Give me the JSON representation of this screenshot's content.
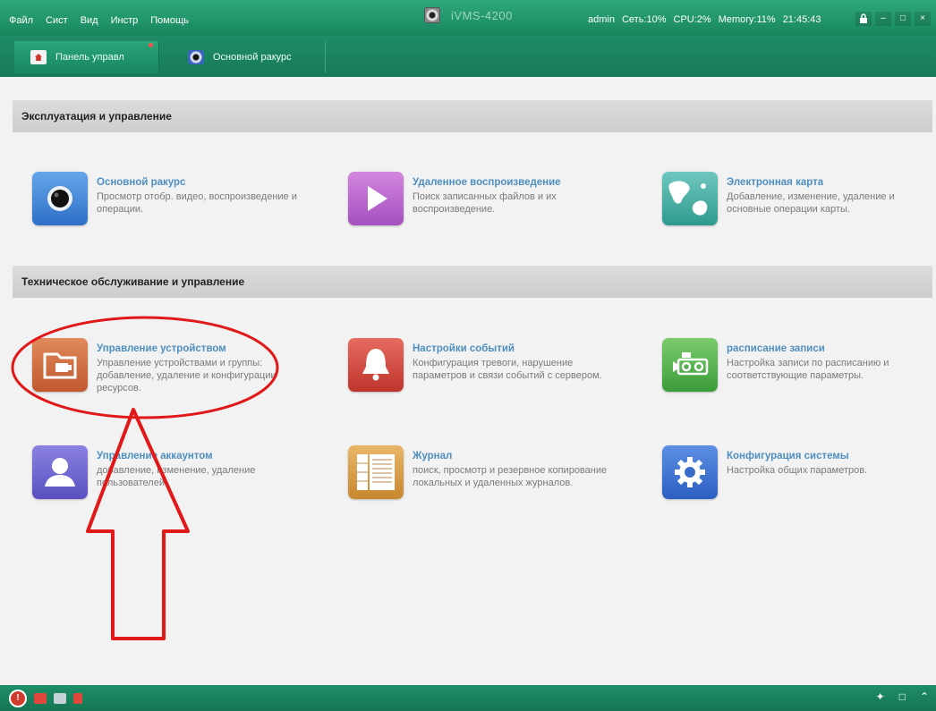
{
  "titlebar": {
    "menu": [
      "Файл",
      "Сист",
      "Вид",
      "Инстр",
      "Помощь"
    ],
    "app_name": "iVMS-4200",
    "user": "admin",
    "net": "Сеть:10%",
    "cpu": "CPU:2%",
    "memory": "Memory:11%",
    "time": "21:45:43",
    "lock_icon": "lock-icon",
    "min_label": "–",
    "max_label": "□",
    "close_label": "×"
  },
  "tabs": [
    {
      "label": "Панель управл",
      "icon": "home-icon",
      "active": true
    },
    {
      "label": "Основной ракурс",
      "icon": "camera-icon",
      "active": false
    }
  ],
  "sections": [
    {
      "title": "Эксплуатация и управление",
      "tiles": [
        {
          "title": "Основной ракурс",
          "desc": "Просмотр отобр. видео, воспроизведение и операции.",
          "icon": "camera-icon"
        },
        {
          "title": "Удаленное воспроизведение",
          "desc": "Поиск записанных файлов и их воспроизведение.",
          "icon": "play-icon"
        },
        {
          "title": "Электронная карта",
          "desc": "Добавление, изменение, удаление и основные операции карты.",
          "icon": "map-icon"
        }
      ]
    },
    {
      "title": "Техническое обслуживание и управление",
      "tiles": [
        {
          "title": "Управление устройством",
          "desc": "Управление устройствами и группы: добавление, удаление и конфигурации ресурсов.",
          "icon": "folder-icon"
        },
        {
          "title": "Настройки событий",
          "desc": "Конфигурация тревоги, нарушение параметров и связи событий с сервером.",
          "icon": "bell-icon"
        },
        {
          "title": "расписание записи",
          "desc": "Настройка записи по расписанию и соответствующие параметры.",
          "icon": "recorder-icon"
        },
        {
          "title": "Управление аккаунтом",
          "desc": "добавление, изменение, удаление пользователей.",
          "icon": "user-icon"
        },
        {
          "title": "Журнал",
          "desc": "поиск, просмотр и резервное копирование локальных и удаленных журналов.",
          "icon": "log-icon"
        },
        {
          "title": "Конфигурация системы",
          "desc": "Настройка общих параметров.",
          "icon": "gear-icon"
        }
      ]
    }
  ],
  "bottombar": {
    "alarm_label": "!",
    "pin_label": "✦",
    "restore_label": "□",
    "expand_label": "⌃"
  },
  "colors": {
    "titlebar_green": "#1a8a63",
    "section_header": "#d4d4d4",
    "tile_title": "#4f8fbf",
    "annotation_red": "#e01818"
  }
}
